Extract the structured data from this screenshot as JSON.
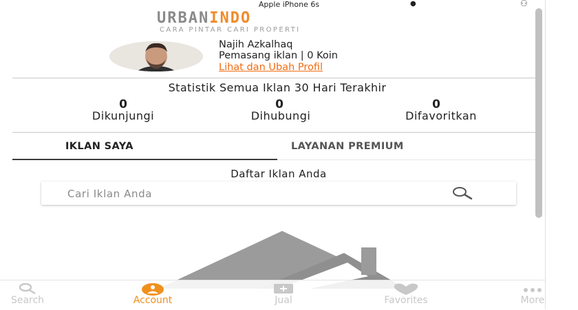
{
  "status_bar": {
    "carrier": "Apple iPhone 6s"
  },
  "logo": {
    "brand_part1": "URBAN",
    "brand_part2": "INDO",
    "tagline": "CARA PINTAR CARI PROPERTI"
  },
  "profile": {
    "name": "Najih Azkalhaq",
    "subtitle": "Pemasang iklan | 0 Koin",
    "edit_link": "Lihat dan Ubah Profil"
  },
  "stats": {
    "title": "Statistik Semua Iklan 30 Hari Terakhir",
    "items": [
      {
        "value": "0",
        "label": "Dikunjungi"
      },
      {
        "value": "0",
        "label": "Dihubungi"
      },
      {
        "value": "0",
        "label": "Difavoritkan"
      }
    ]
  },
  "tabs": [
    {
      "label": "IKLAN SAYA",
      "active": true
    },
    {
      "label": "LAYANAN PREMIUM",
      "active": false
    }
  ],
  "listing": {
    "heading": "Daftar Iklan Anda",
    "search_placeholder": "Cari Iklan Anda"
  },
  "bottom_nav": [
    {
      "label": "Search",
      "icon": "search-icon",
      "active": false
    },
    {
      "label": "Account",
      "icon": "account-icon",
      "active": true
    },
    {
      "label": "Jual",
      "icon": "add-icon",
      "active": false
    },
    {
      "label": "Favorites",
      "icon": "heart-icon",
      "active": false
    },
    {
      "label": "More",
      "icon": "more-icon",
      "active": false
    }
  ],
  "colors": {
    "accent": "#f26b11",
    "brand_orange": "#f08a2a",
    "brand_gray": "#8a8a8a",
    "tab_active": "#f0901e",
    "tab_inactive": "#c8c8c8"
  }
}
